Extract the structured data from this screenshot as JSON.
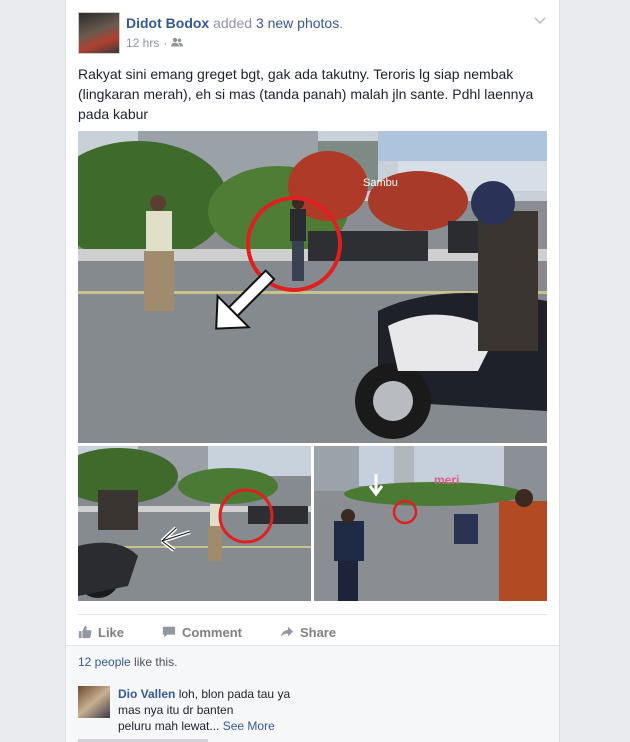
{
  "post": {
    "author": "Didot Bodox",
    "action_prefix": "added",
    "action_count": "3 new photos",
    "action_suffix": ".",
    "time": "12 hrs",
    "separator": "·",
    "audience_icon": "friends-icon",
    "menu_icon": "chevron-down-icon",
    "text": "Rakyat sini emang greget bgt, gak ada takutny. Teroris lg siap nembak (lingkaran merah), eh si mas (tanda panah) malah jln sante. Pdhl laennya pada kabur"
  },
  "photos": {
    "main_watermark": "Sambu",
    "bottom_right_watermark": "meri"
  },
  "actions": {
    "like": "Like",
    "comment": "Comment",
    "share": "Share"
  },
  "likes": {
    "people": "12 people",
    "suffix": " like this."
  },
  "comment": {
    "author": "Dio Vallen",
    "text_line1": " loh, blon pada tau ya",
    "text_line2": "mas nya itu dr banten",
    "text_line3": "peluru mah lewat...",
    "see_more": "See More"
  },
  "colors": {
    "link": "#365899",
    "meta": "#90949c",
    "annotation_circle": "#e02020",
    "background": "#e9ebee"
  }
}
